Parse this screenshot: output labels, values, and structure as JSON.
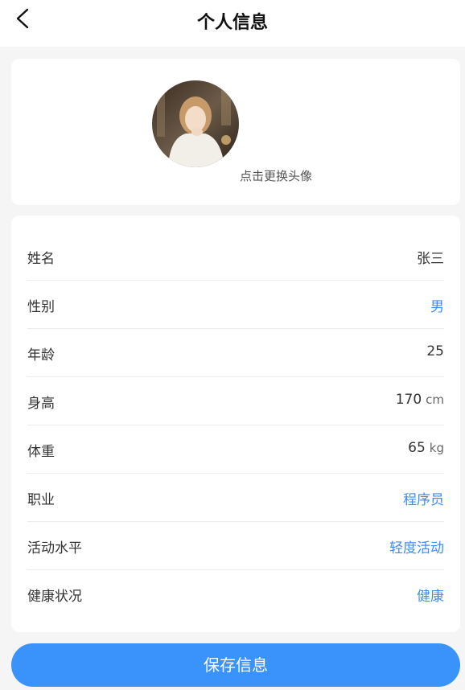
{
  "header": {
    "title": "个人信息",
    "back_icon": "chevron-left-icon"
  },
  "avatar": {
    "hint": "点击更换头像"
  },
  "colors": {
    "accent": "#3a92fb",
    "link": "#3d8cf0",
    "background": "#f5f5f5"
  },
  "profile": {
    "name": {
      "label": "姓名",
      "value": "张三"
    },
    "gender": {
      "label": "性别",
      "value": "男"
    },
    "age": {
      "label": "年龄",
      "value": "25"
    },
    "height": {
      "label": "身高",
      "value": "170",
      "unit": "cm"
    },
    "weight": {
      "label": "体重",
      "value": "65",
      "unit": "kg"
    },
    "occupation": {
      "label": "职业",
      "value": "程序员"
    },
    "activity_level": {
      "label": "活动水平",
      "value": "轻度活动"
    },
    "health_status": {
      "label": "健康状况",
      "value": "健康"
    }
  },
  "actions": {
    "save_label": "保存信息"
  }
}
